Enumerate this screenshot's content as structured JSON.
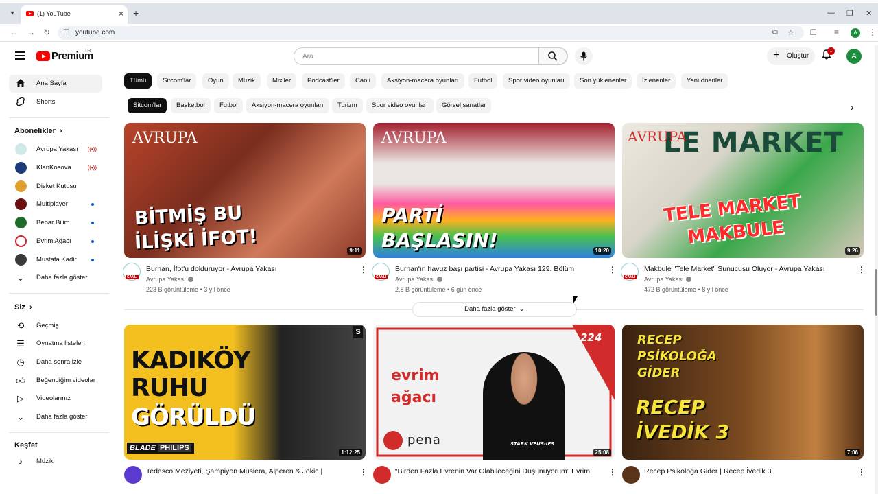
{
  "browser": {
    "tab_title": "(1) YouTube",
    "url": "youtube.com"
  },
  "header": {
    "logo_text": "Premium",
    "country_code": "TR",
    "search_placeholder": "Ara",
    "create_label": "Oluştur",
    "notification_count": "1",
    "avatar_letter": "A"
  },
  "sidebar": {
    "home": "Ana Sayfa",
    "shorts": "Shorts",
    "subs_title": "Abonelikler",
    "subscriptions": [
      {
        "name": "Avrupa Yakası",
        "color": "#cfe8ea",
        "status": "live"
      },
      {
        "name": "KlanKosova",
        "color": "#1a3a7a",
        "status": "live"
      },
      {
        "name": "Disket Kutusu",
        "color": "#e0a030",
        "status": "none"
      },
      {
        "name": "Multiplayer",
        "color": "#6b0f0f",
        "status": "dot"
      },
      {
        "name": "Bebar Bilim",
        "color": "#1f6b2a",
        "status": "dot"
      },
      {
        "name": "Evrim Ağacı",
        "color": "#d6202a",
        "status": "dot"
      },
      {
        "name": "Mustafa Kadir",
        "color": "#3a3a3a",
        "status": "dot"
      }
    ],
    "show_more": "Daha fazla göster",
    "you_title": "Siz",
    "you_items": [
      "Geçmiş",
      "Oynatma listeleri",
      "Daha sonra izle",
      "Beğendiğim videolar",
      "Videolarınız",
      "Daha fazla göster"
    ],
    "explore_title": "Keşfet",
    "explore_items": [
      "Müzik"
    ]
  },
  "chips_row1": [
    "Tümü",
    "Sitcom'lar",
    "Oyun",
    "Müzik",
    "Mix'ler",
    "Podcast'ler",
    "Canlı",
    "Aksiyon-macera oyunları",
    "Futbol",
    "Spor video oyunları",
    "Son yüklenenler",
    "İzlenenler",
    "Yeni öneriler"
  ],
  "chips_row2": [
    "Sitcom'lar",
    "Basketbol",
    "Futbol",
    "Aksiyon-macera oyunları",
    "Turizm",
    "Spor video oyunları",
    "Görsel sanatlar"
  ],
  "videos": [
    {
      "title": "Burhan, İfot'u dolduruyor - Avrupa Yakası",
      "channel": "Avrupa Yakası",
      "meta": "223 B görüntüleme • 3 yıl önce",
      "duration": "9:11",
      "thumb_text_1": "BİTMİŞ BU",
      "thumb_text_2": "İLİŞKİ İFOT!",
      "thumb_brand": "AVRUPA",
      "avatar_badge": "CANLI"
    },
    {
      "title": "Burhan'ın havuz başı partisi - Avrupa Yakası 129. Bölüm",
      "channel": "Avrupa Yakası",
      "meta": "2,8 B görüntüleme • 6 gün önce",
      "duration": "10:20",
      "thumb_text_1": "PARTİ",
      "thumb_text_2": "BAŞLASIN!",
      "thumb_brand": "AVRUPA",
      "avatar_badge": "CANLI"
    },
    {
      "title": "Makbule \"Tele Market\" Sunucusu Oluyor - Avrupa Yakası",
      "channel": "Avrupa Yakası",
      "meta": "472 B görüntüleme • 8 yıl önce",
      "duration": "9:26",
      "thumb_text_1": "TELE MARKET",
      "thumb_text_2": "MAKBULE",
      "thumb_brand": "AVRUPA",
      "thumb_top": "LE MARKET",
      "avatar_badge": "CANLI"
    },
    {
      "title": "Tedesco Meziyeti, Şampiyon Muslera, Alperen & Jokic |",
      "duration": "1:12:25",
      "thumb_text_1": "KADIKÖY",
      "thumb_text_2": "RUHU",
      "thumb_text_3": "GÖRÜLDÜ",
      "thumb_brand": "BLADE",
      "thumb_brand_2": "PHILIPS",
      "thumb_corner": "S"
    },
    {
      "title": "“Birden Fazla Evrenin Var Olabileceğini Düşünüyorum” Evrim",
      "duration": "25:08",
      "thumb_text_1": "evrim",
      "thumb_text_2": "ağacı",
      "thumb_brand": "pena",
      "thumb_number": "224",
      "thumb_shirt": "STARK VEUS-IES"
    },
    {
      "title": "Recep Psikoloğa Gider | Recep İvedik 3",
      "duration": "7:06",
      "thumb_text_1": "RECEP",
      "thumb_text_2": "PSİKOLOĞA",
      "thumb_text_3": "GİDER",
      "thumb_text_4": "RECEP",
      "thumb_text_5": "İVEDİK 3"
    }
  ],
  "show_more_videos": "Daha fazla göster"
}
